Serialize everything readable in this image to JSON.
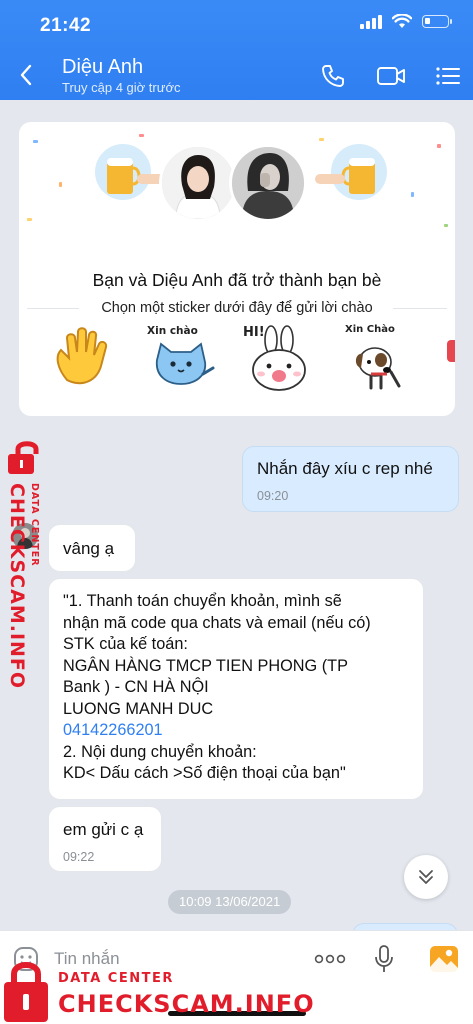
{
  "status_bar": {
    "time": "21:42",
    "battery_level": 0.25
  },
  "header": {
    "contact_name": "Diệu Anh",
    "contact_status": "Truy cập 4 giờ trước",
    "icons": [
      "back-icon",
      "phone-icon",
      "video-call-icon",
      "menu-icon"
    ]
  },
  "friend_card": {
    "title": "Bạn và Diệu Anh đã trở thành bạn bè",
    "subtitle": "Chọn một sticker dưới đây để gửi lời chào",
    "stickers": [
      {
        "name": "wave-hand",
        "caption": ""
      },
      {
        "name": "blue-cat",
        "caption": "Xin chào"
      },
      {
        "name": "white-rabbit",
        "caption": "HI!"
      },
      {
        "name": "dog",
        "caption": "Xin Chào"
      }
    ]
  },
  "messages": [
    {
      "sender": "me",
      "text": "Nhắn đây xíu c rep nhé",
      "time": "09:20"
    },
    {
      "sender": "them",
      "text": "vâng ạ"
    },
    {
      "sender": "them",
      "lines": [
        "\"1. Thanh toán chuyển khoản, mình sẽ",
        "nhận mã code qua chats và email (nếu có)",
        "STK của kế toán:",
        "NGÂN HÀNG TMCP TIEN PHONG (TP",
        "Bank ) - CN HÀ NỘI",
        "LUONG MANH DUC",
        "04142266201",
        "2. Nội dung chuyển khoản:",
        "KD< Dấu cách >Số điện thoại của bạn\""
      ]
    },
    {
      "sender": "them",
      "text": "em gửi c ạ",
      "time": "09:22"
    }
  ],
  "date_divider": "10:09 13/06/2021",
  "input": {
    "placeholder": "Tin nhắn"
  },
  "watermark": {
    "small": "DATA CENTER",
    "big": "CHECKSCAM.INFO"
  },
  "colors": {
    "header_blue": "#2f7ff2",
    "my_bubble": "#d9ecff",
    "link": "#2f7ff2",
    "watermark_red": "#e11d2b"
  }
}
